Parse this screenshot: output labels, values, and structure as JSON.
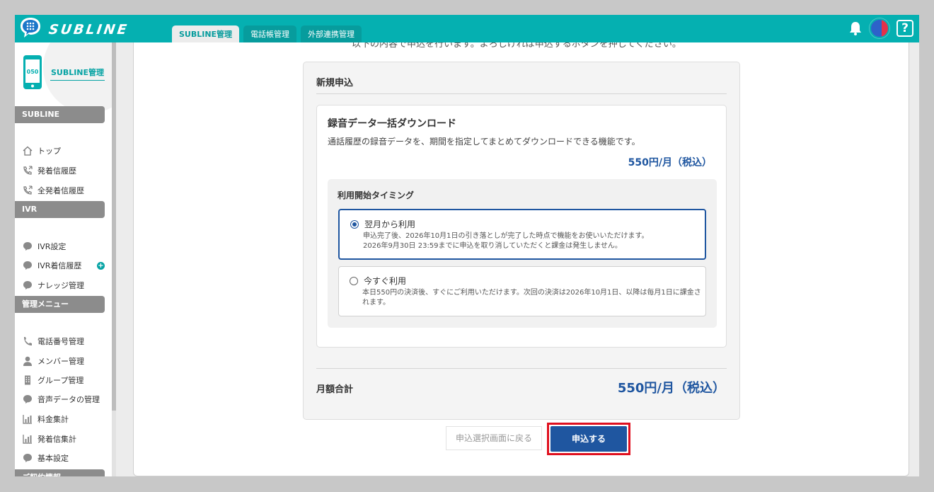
{
  "app": {
    "name": "SUBLINE"
  },
  "header": {
    "tabs": [
      {
        "label": "SUBLINE管理",
        "active": true
      },
      {
        "label": "電話帳管理",
        "active": false
      },
      {
        "label": "外部連携管理",
        "active": false
      }
    ],
    "help_label": "?"
  },
  "sidebar": {
    "brand": {
      "label": "SUBLINE管理",
      "phone_number_prefix": "050"
    },
    "sections": [
      {
        "title": "SUBLINE",
        "items": [
          {
            "label": "トップ",
            "icon": "home-icon"
          },
          {
            "label": "発着信履歴",
            "icon": "phone-icon"
          },
          {
            "label": "全発着信履歴",
            "icon": "phone-icon"
          }
        ]
      },
      {
        "title": "IVR",
        "items": [
          {
            "label": "IVR設定",
            "icon": "speech-bubble-icon"
          },
          {
            "label": "IVR着信履歴",
            "icon": "speech-bubble-icon",
            "badge": "+"
          },
          {
            "label": "ナレッジ管理",
            "icon": "speech-bubble-icon"
          }
        ]
      },
      {
        "title": "管理メニュー",
        "items": [
          {
            "label": "電話番号管理",
            "icon": "phone-handset-icon"
          },
          {
            "label": "メンバー管理",
            "icon": "user-icon"
          },
          {
            "label": "グループ管理",
            "icon": "building-icon"
          },
          {
            "label": "音声データの管理",
            "icon": "speech-bubble-icon"
          },
          {
            "label": "料金集計",
            "icon": "bar-chart-icon"
          },
          {
            "label": "発着信集計",
            "icon": "bar-chart-icon"
          },
          {
            "label": "基本設定",
            "icon": "speech-bubble-icon"
          }
        ]
      },
      {
        "title": "ご契約情報",
        "items": []
      }
    ]
  },
  "main": {
    "cut_text": "以下の内容で申込を行います。よろしければ申込するボタンを押してください。",
    "panel": {
      "title": "新規申込",
      "service": {
        "title": "録音データ一括ダウンロード",
        "description": "通話履歴の録音データを、期間を指定してまとめてダウンロードできる機能です。",
        "price": "550円/月（税込）"
      },
      "timing": {
        "title": "利用開始タイミング",
        "options": [
          {
            "label": "翌月から利用",
            "selected": true,
            "note_line1": "申込完了後、2026年10月1日の引き落としが完了した時点で機能をお使いいただけます。",
            "note_line2": "2026年9月30日 23:59までに申込を取り消していただくと課金は発生しません。"
          },
          {
            "label": "今すぐ利用",
            "selected": false,
            "note_line1": "本日550円の決済後、すぐにご利用いただけます。次回の決済は2026年10月1日、以降は毎月1日に課金されます。"
          }
        ]
      },
      "total_label": "月額合計",
      "total_price": "550円/月（税込）"
    },
    "buttons": {
      "back_label": "申込選択画面に戻る",
      "submit_label": "申込する"
    }
  },
  "colors": {
    "header": "#05b0b1",
    "accent_blue": "#1f56a0",
    "highlight_red": "#e0101f",
    "section_gray": "#8c8c8c"
  }
}
